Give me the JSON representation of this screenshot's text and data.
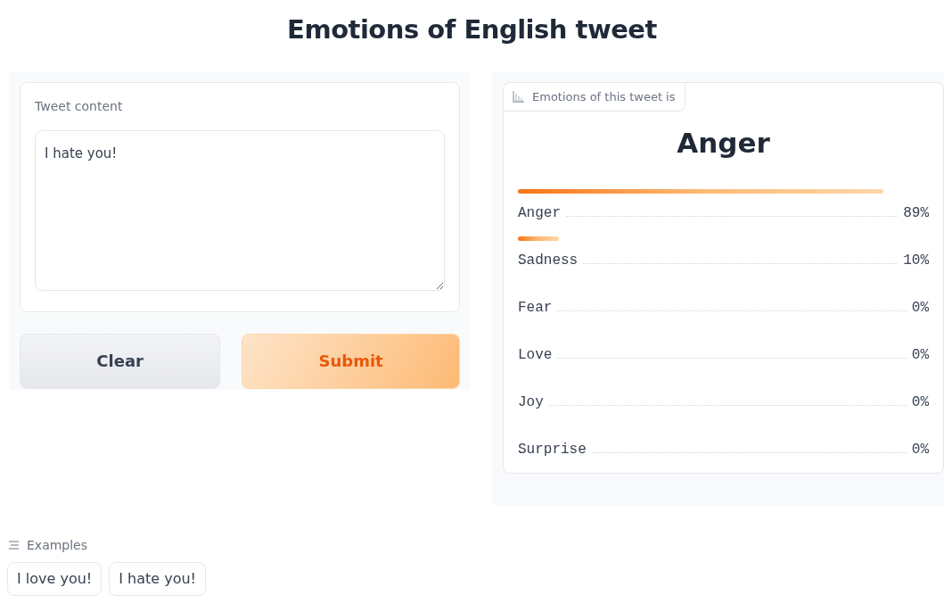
{
  "title": "Emotions of English tweet",
  "input": {
    "label": "Tweet content",
    "value": "I hate you!"
  },
  "buttons": [
    {
      "label": "Clear",
      "kind": "secondary"
    },
    {
      "label": "Submit",
      "kind": "primary"
    }
  ],
  "output": {
    "label": "Emotions of this tweet is",
    "top": "Anger",
    "confidences": [
      {
        "name": "Anger",
        "reading": "89%"
      },
      {
        "name": "Sadness",
        "reading": "10%"
      },
      {
        "name": "Fear",
        "reading": "0%"
      },
      {
        "name": "Love",
        "reading": "0%"
      },
      {
        "name": "Joy",
        "reading": "0%"
      },
      {
        "name": "Surprise",
        "reading": "0%"
      }
    ]
  },
  "examples": {
    "label": "Examples",
    "items": [
      "I love you!",
      "I hate you!"
    ]
  }
}
